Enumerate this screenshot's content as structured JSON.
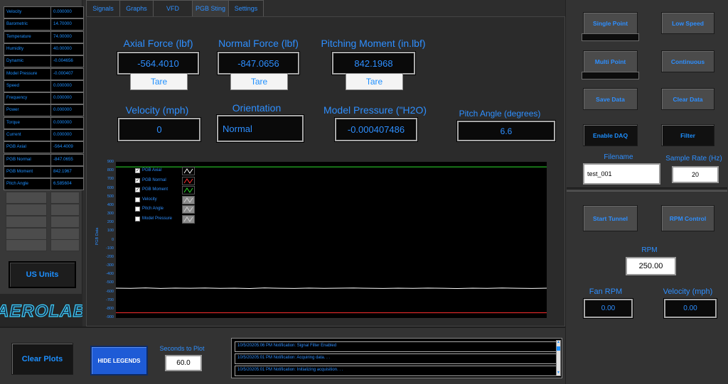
{
  "readouts": [
    {
      "name": "Velocity",
      "value": "0.000000"
    },
    {
      "name": "Barometric",
      "value": "14.70000"
    },
    {
      "name": "Temperature",
      "value": "74.00000"
    },
    {
      "name": "Humidity",
      "value": "40.00000"
    },
    {
      "name": "Dynamic",
      "value": "-0.004656"
    },
    {
      "name": "Model Pressure",
      "value": "-0.000407"
    },
    {
      "name": "Speed",
      "value": "0.000000"
    },
    {
      "name": "Frequency",
      "value": "0.000000"
    },
    {
      "name": "Power",
      "value": "0.000000"
    },
    {
      "name": "Torque",
      "value": "0.000000"
    },
    {
      "name": "Current",
      "value": "0.000000"
    },
    {
      "name": "PGB Axial",
      "value": "-564.4009"
    },
    {
      "name": "PGB Normal",
      "value": "-847.0655"
    },
    {
      "name": "PGB Moment",
      "value": "842.1967"
    },
    {
      "name": "Pitch Angle",
      "value": "6.585604"
    }
  ],
  "units_button": "US Units",
  "logo_text": "AEROLAB",
  "tabs": [
    {
      "label": "Signals"
    },
    {
      "label": "Graphs"
    },
    {
      "label": "VFD"
    },
    {
      "label": "PGB Sting"
    },
    {
      "label": "Settings"
    }
  ],
  "pgb": {
    "axial": {
      "label": "Axial Force (lbf)",
      "value": "-564.4010",
      "tare": "Tare"
    },
    "normal": {
      "label": "Normal Force (lbf)",
      "value": "-847.0656",
      "tare": "Tare"
    },
    "moment": {
      "label": "Pitching Moment (in.lbf)",
      "value": "842.1968",
      "tare": "Tare"
    },
    "velocity": {
      "label": "Velocity (mph)",
      "value": "0"
    },
    "orientation": {
      "label": "Orientation",
      "value": "Normal"
    },
    "model_pressure": {
      "label": "Model Pressure (\"H2O)",
      "value": "-0.000407486"
    },
    "pitch_angle": {
      "label": "Pitch Angle (degrees)",
      "value": "6.6"
    }
  },
  "chart_data": {
    "type": "line",
    "ylabel": "PGB Data",
    "ylim": [
      -900,
      900
    ],
    "y_ticks": [
      "900",
      "800",
      "700",
      "600",
      "500",
      "400",
      "300",
      "200",
      "100",
      "0",
      "-100",
      "-200",
      "-300",
      "-400",
      "-500",
      "-600",
      "-700",
      "-800",
      "-900"
    ],
    "series": [
      {
        "name": "PGB Axial",
        "checked": true,
        "color": "#ffffff",
        "values": [
          -563,
          -565,
          -560,
          -566,
          -562,
          -564,
          -561,
          -565,
          -563,
          -567,
          -560,
          -564,
          -566,
          -562,
          -565,
          -563,
          -561,
          -564,
          -566,
          -563,
          -565,
          -562,
          -564,
          -567,
          -563,
          -565,
          -561,
          -564,
          -566,
          -563
        ]
      },
      {
        "name": "PGB Normal",
        "checked": true,
        "color": "#ff3030",
        "values": [
          -847,
          -847,
          -847,
          -847,
          -847,
          -847,
          -847,
          -847,
          -847,
          -847,
          -847,
          -847,
          -847,
          -847,
          -847,
          -847,
          -847,
          -847,
          -847,
          -847,
          -847,
          -847,
          -847,
          -847,
          -847,
          -847,
          -847,
          -847,
          -847,
          -847
        ]
      },
      {
        "name": "PGB Moment",
        "checked": true,
        "color": "#2ee02e",
        "values": [
          842,
          842,
          842,
          842,
          842,
          842,
          842,
          842,
          842,
          842,
          842,
          842,
          842,
          842,
          842,
          842,
          842,
          842,
          842,
          842,
          842,
          842,
          842,
          842,
          842,
          842,
          842,
          842,
          842,
          842
        ]
      },
      {
        "name": "Velocity",
        "checked": false,
        "color": "#9a9a9a",
        "values": []
      },
      {
        "name": "Pitch Angle",
        "checked": false,
        "color": "#9a9a9a",
        "values": []
      },
      {
        "name": "Model Pressure",
        "checked": false,
        "color": "#9a9a9a",
        "values": []
      }
    ]
  },
  "right": {
    "single_point": "Single Point",
    "low_speed": "Low Speed",
    "multi_point": "Multi Point",
    "continuous": "Continuous",
    "save_data": "Save Data",
    "clear_data": "Clear Data",
    "enable_daq": "Enable DAQ",
    "filter": "Filter",
    "filename_label": "Filename",
    "filename_value": "test_001",
    "sample_rate_label": "Sample Rate (Hz)",
    "sample_rate_value": "20",
    "start_tunnel": "Start Tunnel",
    "rpm_control": "RPM Control",
    "rpm_label": "RPM",
    "rpm_value": "250.00",
    "fan_rpm_label": "Fan RPM",
    "fan_rpm_value": "0.00",
    "velocity_label": "Velocity (mph)",
    "velocity_value": "0.00"
  },
  "bottom": {
    "clear_plots": "Clear Plots",
    "hide_legends": "HIDE LEGENDS",
    "seconds_label": "Seconds to Plot",
    "seconds_value": "60.0",
    "log": [
      "10/5/20205:06 PM Notification: Signal Filter Enabled",
      "10/5/20205:01 PM Notification: Acquiring data. . .",
      "10/5/20205:01 PM Notification: Initializing acquisition. . ."
    ]
  }
}
